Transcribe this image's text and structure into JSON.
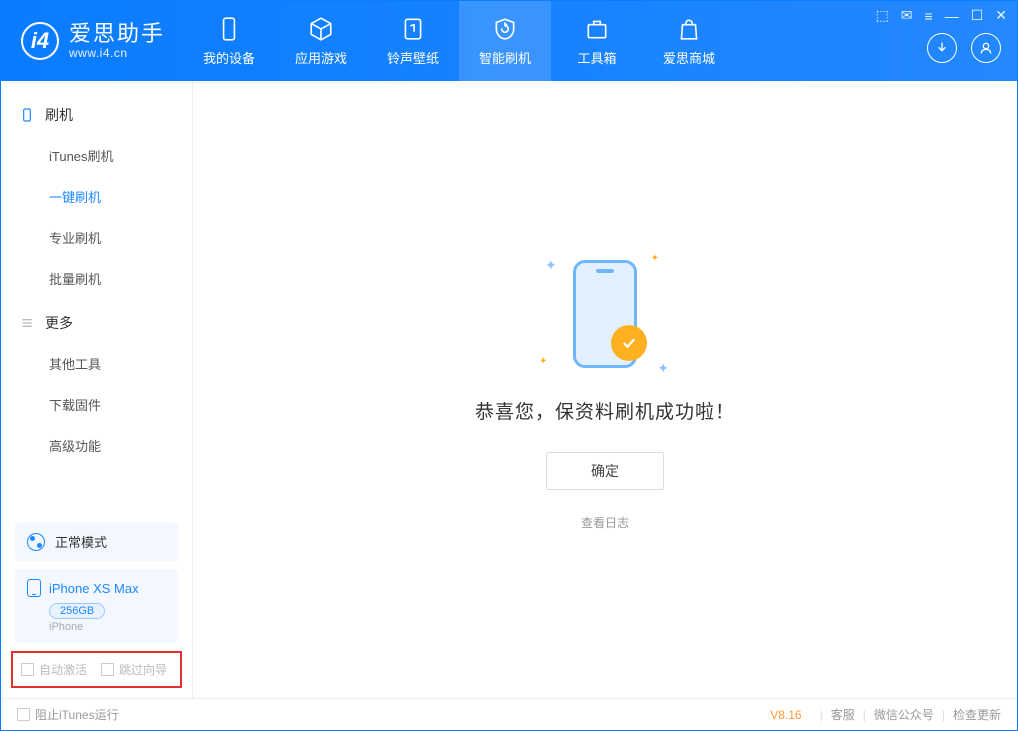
{
  "logo": {
    "title": "爱思助手",
    "subtitle": "www.i4.cn"
  },
  "nav": {
    "items": [
      {
        "label": "我的设备"
      },
      {
        "label": "应用游戏"
      },
      {
        "label": "铃声壁纸"
      },
      {
        "label": "智能刷机"
      },
      {
        "label": "工具箱"
      },
      {
        "label": "爱思商城"
      }
    ]
  },
  "sidebar": {
    "section1": {
      "title": "刷机",
      "items": [
        "iTunes刷机",
        "一键刷机",
        "专业刷机",
        "批量刷机"
      ]
    },
    "section2": {
      "title": "更多",
      "items": [
        "其他工具",
        "下载固件",
        "高级功能"
      ]
    },
    "mode": "正常模式",
    "device": {
      "name": "iPhone XS Max",
      "storage": "256GB",
      "type": "iPhone"
    },
    "checkboxes": {
      "auto_activate": "自动激活",
      "skip_guide": "跳过向导"
    }
  },
  "main": {
    "success_message": "恭喜您，保资料刷机成功啦！",
    "ok_button": "确定",
    "view_log": "查看日志"
  },
  "footer": {
    "block_itunes": "阻止iTunes运行",
    "version": "V8.16",
    "links": [
      "客服",
      "微信公众号",
      "检查更新"
    ]
  }
}
